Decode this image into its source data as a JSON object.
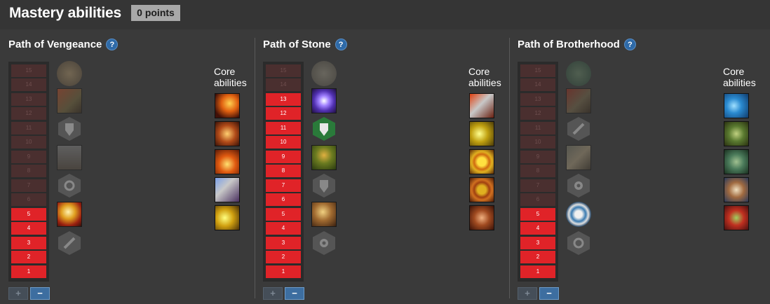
{
  "header": {
    "title": "Mastery abilities",
    "points_badge": "0 points"
  },
  "core_label": "Core abilities",
  "paths": [
    {
      "name": "Path of Vengeance",
      "help_icon": "question-icon",
      "ranks": [
        "15",
        "14",
        "13",
        "12",
        "11",
        "10",
        "9",
        "8",
        "7",
        "6",
        "5",
        "4",
        "3",
        "2",
        "1"
      ],
      "unlocked_rank": 5,
      "mastery_abilities": [
        {
          "icon": "rune-circle-icon",
          "state": "locked"
        },
        {
          "icon": "warrior-charge-icon",
          "state": "locked"
        },
        {
          "icon": "shield-tactic-icon",
          "state": "locked"
        },
        {
          "icon": "sword-pillar-icon",
          "state": "locked"
        },
        {
          "icon": "morale-tactic-icon",
          "state": "locked"
        },
        {
          "icon": "hammer-strike-icon",
          "state": "unlocked"
        },
        {
          "icon": "sword-tactic-icon",
          "state": "locked"
        }
      ],
      "core_abilities": [
        "axe-swing-icon",
        "axe-slash-icon",
        "mace-blow-icon",
        "double-axe-icon",
        "hammer-smash-icon"
      ],
      "plus_label": "+",
      "minus_label": "−"
    },
    {
      "name": "Path of Stone",
      "help_icon": "question-icon",
      "ranks": [
        "15",
        "14",
        "13",
        "12",
        "11",
        "10",
        "9",
        "8",
        "7",
        "6",
        "5",
        "4",
        "3",
        "2",
        "1"
      ],
      "unlocked_rank": 13,
      "mastery_abilities": [
        {
          "icon": "stone-rune-icon",
          "state": "locked"
        },
        {
          "icon": "spirit-orb-icon",
          "state": "unlocked"
        },
        {
          "icon": "shield-tactic-icon",
          "state": "unlocked"
        },
        {
          "icon": "dwarf-defender-icon",
          "state": "unlocked"
        },
        {
          "icon": "shield-tactic-icon",
          "state": "locked"
        },
        {
          "icon": "rally-warrior-icon",
          "state": "unlocked"
        },
        {
          "icon": "gear-tactic-icon",
          "state": "locked"
        }
      ],
      "core_abilities": [
        "sword-cleave-icon",
        "axe-chop-icon",
        "gold-shield-icon",
        "bronze-shield-icon",
        "whirlwind-icon"
      ],
      "plus_label": "+",
      "minus_label": "−"
    },
    {
      "name": "Path of Brotherhood",
      "help_icon": "question-icon",
      "ranks": [
        "15",
        "14",
        "13",
        "12",
        "11",
        "10",
        "9",
        "8",
        "7",
        "6",
        "5",
        "4",
        "3",
        "2",
        "1"
      ],
      "unlocked_rank": 5,
      "mastery_abilities": [
        {
          "icon": "clan-rune-icon",
          "state": "locked"
        },
        {
          "icon": "war-cry-icon",
          "state": "locked"
        },
        {
          "icon": "sword-tactic-icon",
          "state": "locked"
        },
        {
          "icon": "spear-volley-icon",
          "state": "locked"
        },
        {
          "icon": "gear-tactic-icon",
          "state": "locked"
        },
        {
          "icon": "brotherhood-seal-icon",
          "state": "unlocked"
        },
        {
          "icon": "morale-tactic-icon",
          "state": "locked"
        }
      ],
      "core_abilities": [
        "blue-shield-icon",
        "greenskin-icon",
        "dwarf-guard-icon",
        "dwarf-elder-icon",
        "goblin-strike-icon"
      ],
      "plus_label": "+",
      "minus_label": "−"
    }
  ],
  "colors": {
    "background": "#3a3a3a",
    "header_background": "#353535",
    "rank_unlocked": "#e02328",
    "rank_locked": "#4a2f2f",
    "points_badge": "#a8a8a8",
    "help_icon": "#2e6aa8",
    "minus_button": "#3d6ea0"
  }
}
